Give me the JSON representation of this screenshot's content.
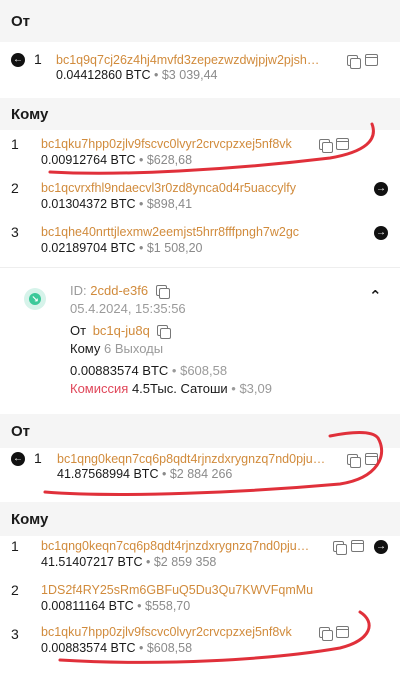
{
  "section1": {
    "from_title": "От",
    "from": [
      {
        "index": "1",
        "address": "bc1q9q7cj26z4hj4mvfd3zepezwzdwjpjw2pjsh…",
        "btc": "0.04412860 BTC",
        "usd": "$3 039,44"
      }
    ],
    "to_title": "Кому",
    "to": [
      {
        "index": "1",
        "address": "bc1qku7hpp0zjlv9fscvc0lvyr2crvcpzxej5nf8vk",
        "btc": "0.00912764 BTC",
        "usd": "$628,68"
      },
      {
        "index": "2",
        "address": "bc1qcvrxfhl9ndaecvl3r0zd8ynca0d4r5uaccylfy",
        "btc": "0.01304372 BTC",
        "usd": "$898,41"
      },
      {
        "index": "3",
        "address": "bc1qhe40nrttjlexmw2eemjst5hrr8fffpngh7w2gc",
        "btc": "0.02189704 BTC",
        "usd": "$1 508,20"
      }
    ]
  },
  "tx": {
    "id_label": "ID:",
    "id_value": "2cdd-e3f6",
    "datetime": "05.4.2024, 15:35:56",
    "from_label": "От",
    "from_value": "bc1q-ju8q",
    "to_label": "Кому",
    "to_value": "6 Выходы",
    "amount_btc": "0.00883574 BTC",
    "amount_usd": "$608,58",
    "fee_label": "Комиссия",
    "fee_value": "4.5Тыс. Сатоши",
    "fee_usd": "$3,09"
  },
  "section2": {
    "from_title": "От",
    "from": [
      {
        "index": "1",
        "address": "bc1qng0keqn7cq6p8qdt4rjnzdxrygnzq7nd0pju…",
        "btc": "41.87568994 BTC",
        "usd": "$2 884 266"
      }
    ],
    "to_title": "Кому",
    "to": [
      {
        "index": "1",
        "address": "bc1qng0keqn7cq6p8qdt4rjnzdxrygnzq7nd0pju…",
        "btc": "41.51407217 BTC",
        "usd": "$2 859 358"
      },
      {
        "index": "2",
        "address": "1DS2f4RY25sRm6GBFuQ5Du3Qu7KWVFqmMu",
        "btc": "0.00811164 BTC",
        "usd": "$558,70"
      },
      {
        "index": "3",
        "address": "bc1qku7hpp0zjlv9fscvc0lvyr2crvcpzxej5nf8vk",
        "btc": "0.00883574 BTC",
        "usd": "$608,58"
      }
    ]
  },
  "colors": {
    "address": "#d18b3c",
    "fee": "#e0475a",
    "annotation": "#e0303a",
    "incoming": "#3cc99a"
  }
}
